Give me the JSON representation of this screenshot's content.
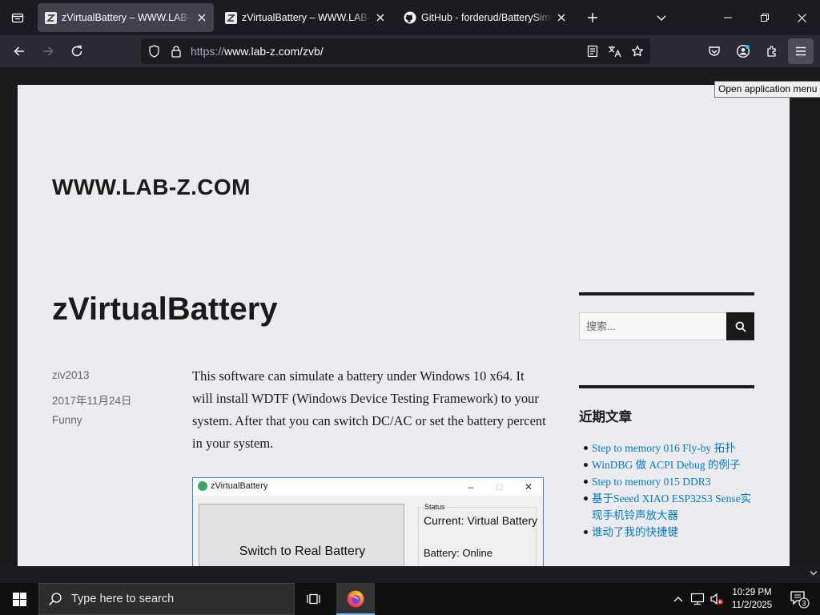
{
  "browser": {
    "tabs": [
      {
        "title": "zVirtualBattery – WWW.LAB-Z.COM",
        "favicon": "lab-z-icon",
        "active": true
      },
      {
        "title": "zVirtualBattery – WWW.LAB-Z.COM",
        "favicon": "lab-z-icon",
        "active": false
      },
      {
        "title": "GitHub - forderud/BatterySimulator",
        "favicon": "github-icon",
        "active": false
      }
    ],
    "url_scheme": "https://",
    "url_rest": "www.lab-z.com/zvb/",
    "tooltip": "Open application menu"
  },
  "page": {
    "site_title": "WWW.LAB-Z.COM",
    "post_title": "zVirtualBattery",
    "meta": {
      "author": "ziv2013",
      "date": "2017年11月24日",
      "category": "Funny"
    },
    "body": "This software can simulate a battery under Windows 10 x64. It will install WDTF (Windows Device Testing Framework) to your system. After that you can switch DC/AC or set the battery percent in your system.",
    "screenshot": {
      "window_title": "zVirtualBattery",
      "switch_button": "Switch to Real Battery",
      "status_label": "Status",
      "current": "Current: Virtual Battery",
      "battery": "Battery: Online"
    },
    "sidebar": {
      "search_placeholder": "搜索...",
      "recent_title": "近期文章",
      "recent_posts": [
        "Step to memory 016 Fly-by 拓扑",
        "WinDBG 做 ACPI Debug 的例子",
        "Step to memory 015 DDR3",
        "基于Seeed XIAO ESP32S3 Sense实现手机铃声放大器",
        "谁动了我的快捷键"
      ]
    }
  },
  "taskbar": {
    "search_placeholder": "Type here to search",
    "time": "10:29 PM",
    "date": "11/2/2025",
    "notification_count": "3"
  },
  "colors": {
    "tab_bg": "#1c1b22",
    "nav_bg": "#2b2a33",
    "page_bg": "#ececf0",
    "link": "#007acc"
  }
}
